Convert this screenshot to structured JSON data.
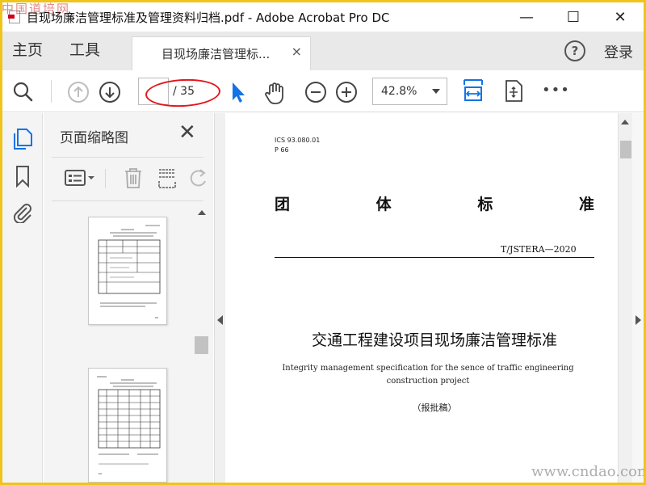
{
  "window": {
    "title": "目现场廉洁管理标准及管理资料归档.pdf - Adobe Acrobat Pro DC",
    "minimize": "—",
    "maximize": "☐",
    "close": "✕"
  },
  "tabs": {
    "home": "主页",
    "tools": "工具",
    "doc_tab": "目现场廉洁管理标...",
    "doc_tab_close": "×",
    "help": "?",
    "login": "登录"
  },
  "toolbar": {
    "current_page": "",
    "total_pages": "/ 35",
    "zoom": "42.8%",
    "more": "•••"
  },
  "thumb_panel": {
    "title": "页面缩略图",
    "close": "✕",
    "thumbnails": [
      {
        "page_label": "15"
      },
      {
        "page_label": ""
      }
    ]
  },
  "document": {
    "ics": "ICS 93.080.01",
    "p_code": "P 66",
    "std_type": [
      "团",
      "体",
      "标",
      "准"
    ],
    "std_code": "T/JSTERA—2020",
    "title_cn": "交通工程建设项目现场廉洁管理标准",
    "title_en": "Integrity management specification for the sence of traffic engineering construction project",
    "draft": "（报批稿）"
  },
  "watermarks": {
    "top": "中国道培网",
    "bottom": "www.cndao.com"
  },
  "colors": {
    "frame": "#f0c419",
    "accent_blue": "#1473e6",
    "annotation_red": "#e3161b"
  }
}
